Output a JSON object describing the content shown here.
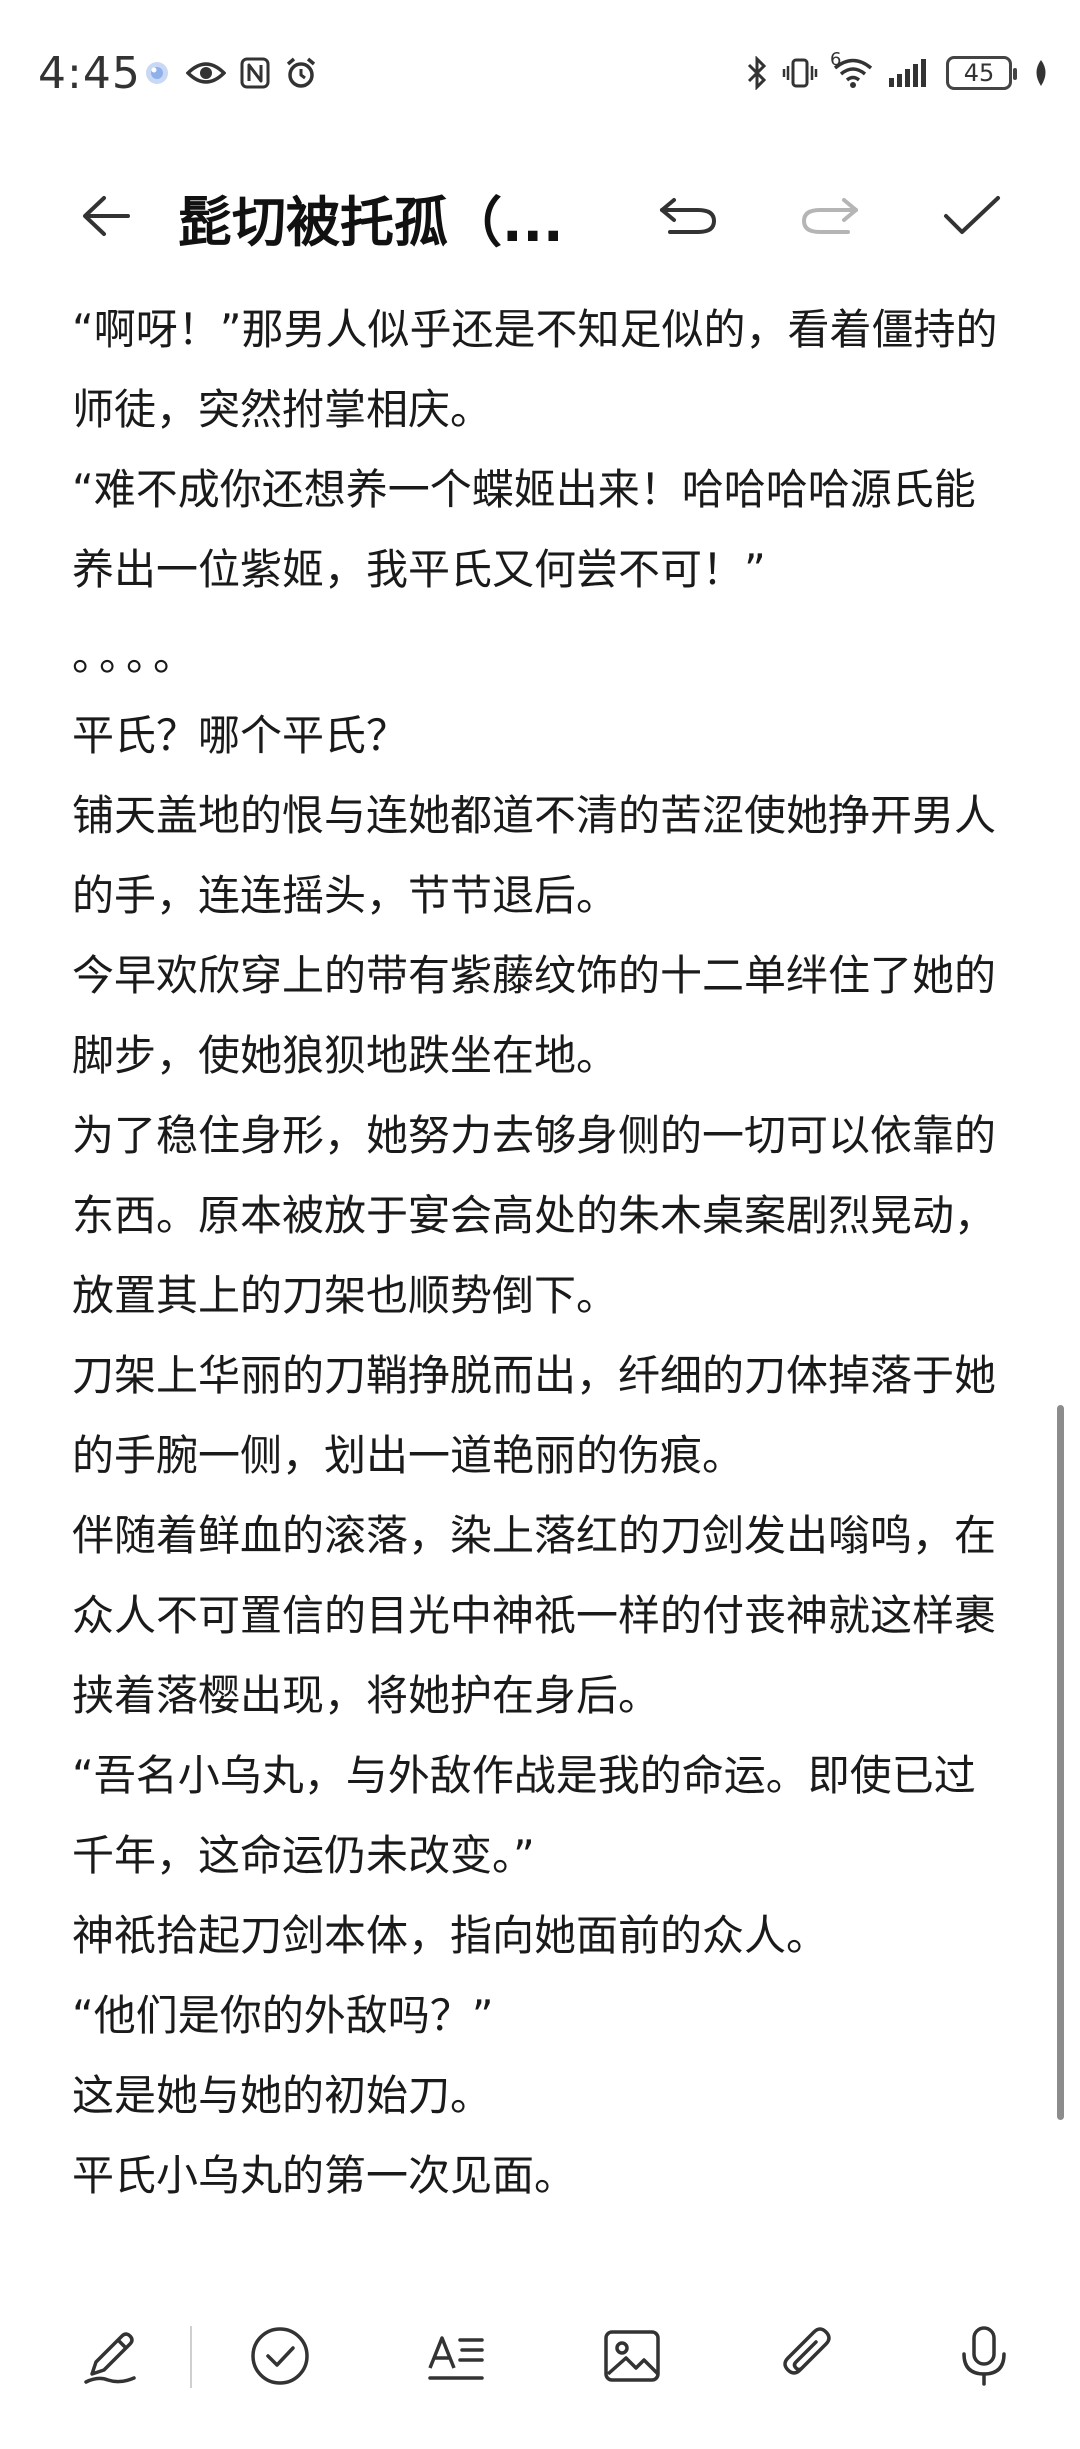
{
  "status_bar": {
    "time": "4:45",
    "battery_level": "45",
    "network_label": "6",
    "left_icons": [
      "ai-assistant-icon",
      "eye-icon",
      "nfc-icon",
      "alarm-icon"
    ],
    "right_icons": [
      "bluetooth-icon",
      "vibrate-icon",
      "wifi-icon",
      "signal-icon",
      "battery-icon",
      "leaf-icon"
    ]
  },
  "header": {
    "title": "髭切被托孤（...",
    "icons": [
      "back-arrow-icon",
      "undo-icon",
      "redo-icon",
      "check-icon"
    ]
  },
  "content": {
    "paragraphs": [
      "“啊呀！”那男人似乎还是不知足似的，看着僵持的师徒，突然拊掌相庆。",
      "“难不成你还想养一个蝶姬出来！哈哈哈哈源氏能养出一位紫姬，我平氏又何尝不可！”",
      "。。。。",
      "平氏？哪个平氏？",
      "铺天盖地的恨与连她都道不清的苦涩使她挣开男人的手，连连摇头，节节退后。",
      "今早欢欣穿上的带有紫藤纹饰的十二单绊住了她的脚步，使她狼狈地跌坐在地。",
      "为了稳住身形，她努力去够身侧的一切可以依靠的东西。原本被放于宴会高处的朱木桌案剧烈晃动，放置其上的刀架也顺势倒下。",
      "刀架上华丽的刀鞘挣脱而出，纤细的刀体掉落于她的手腕一侧，划出一道艳丽的伤痕。",
      "伴随着鲜血的滚落，染上落红的刀剑发出嗡鸣，在众人不可置信的目光中神祇一样的付丧神就这样裹挟着落樱出现，将她护在身后。",
      "“吾名小乌丸，与外敌作战是我的命运。即使已过千年，这命运仍未改变。”",
      "神祇拾起刀剑本体，指向她面前的众人。",
      "“他们是你的外敌吗？”",
      "这是她与她的初始刀。",
      "平氏小乌丸的第一次见面。"
    ]
  },
  "toolbar": {
    "icons": [
      "pen-icon",
      "checklist-icon",
      "text-format-icon",
      "image-icon",
      "attachment-icon",
      "microphone-icon"
    ]
  },
  "colors": {
    "text": "#1a1a1a",
    "icon": "#333333",
    "disabled_icon": "#b5b5b5",
    "background": "#ffffff"
  }
}
